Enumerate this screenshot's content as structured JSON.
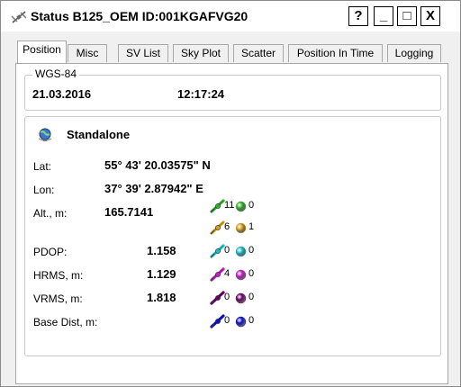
{
  "window": {
    "title": "Status B125_OEM ID:001KGAFVG20",
    "help_label": "?",
    "minimize_label": "_",
    "maximize_label": "□",
    "close_label": "X"
  },
  "tabs": [
    {
      "label": "Position",
      "active": true
    },
    {
      "label": "Misc"
    },
    {
      "label": "SV List"
    },
    {
      "label": "Sky Plot"
    },
    {
      "label": "Scatter"
    },
    {
      "label": "Position In Time"
    },
    {
      "label": "Logging"
    }
  ],
  "datum": {
    "label": "WGS-84",
    "date": "21.03.2016",
    "time": "12:17:24"
  },
  "solution": {
    "mode": "Standalone",
    "lat_label": "Lat:",
    "lat_value": "55° 43' 20.03575\" N",
    "lon_label": "Lon:",
    "lon_value": "37° 39' 2.87942\" E",
    "alt_label": "Alt., m:",
    "alt_value": "165.7141",
    "pdop_label": "PDOP:",
    "pdop_value": "1.158",
    "hrms_label": "HRMS, m:",
    "hrms_value": "1.129",
    "vrms_label": "VRMS, m:",
    "vrms_value": "1.818",
    "base_label": "Base Dist, m:"
  },
  "satellites": [
    {
      "color": "#33b233",
      "count": "11",
      "extra": "0"
    },
    {
      "color": "#d4a020",
      "count": "6",
      "extra": "1"
    },
    {
      "color": "#20c0c8",
      "count": "0",
      "extra": "0"
    },
    {
      "color": "#c020c0",
      "count": "4",
      "extra": "0"
    },
    {
      "color": "#6a006a",
      "count": "0",
      "extra": "0"
    },
    {
      "color": "#1010c8",
      "count": "0",
      "extra": "0"
    }
  ],
  "icons": {
    "title": "satellite-icon",
    "mode": "globe-icon",
    "satellite": "satellite-icon",
    "dot": "ball-icon"
  }
}
